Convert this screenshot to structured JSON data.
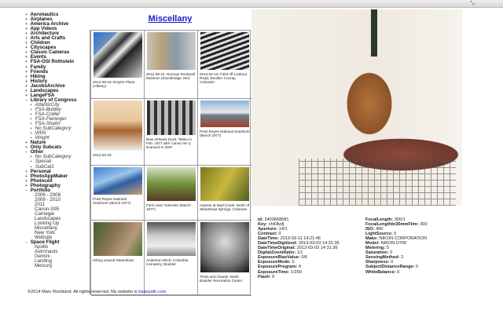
{
  "sidebar": {
    "items": [
      {
        "label": "Aeronautics",
        "level": 0,
        "toggle": "+"
      },
      {
        "label": "Airplanes",
        "level": 0,
        "toggle": "+"
      },
      {
        "label": "America Archive",
        "level": 0,
        "toggle": "+"
      },
      {
        "label": "App Videos",
        "level": 0,
        "toggle": "+"
      },
      {
        "label": "Architecture",
        "level": 0,
        "toggle": "+"
      },
      {
        "label": "Arts and Crafts",
        "level": 0,
        "toggle": "+"
      },
      {
        "label": "Children",
        "level": 0,
        "toggle": "+"
      },
      {
        "label": "Cityscapes",
        "level": 0,
        "toggle": "+"
      },
      {
        "label": "Classic Cameras",
        "level": 0,
        "toggle": "+"
      },
      {
        "label": "Events",
        "level": 0,
        "toggle": "+"
      },
      {
        "label": "FSA-OSI Rothstein",
        "level": 0,
        "toggle": "+"
      },
      {
        "label": "Family",
        "level": 0,
        "toggle": "+"
      },
      {
        "label": "Friends",
        "level": 0,
        "toggle": "+"
      },
      {
        "label": "Hiking",
        "level": 0,
        "toggle": "+"
      },
      {
        "label": "History",
        "level": 0,
        "toggle": "+"
      },
      {
        "label": "JacobsArchive",
        "level": 0,
        "toggle": "+"
      },
      {
        "label": "Landscapes",
        "level": 0,
        "toggle": "+"
      },
      {
        "label": "LangeFSA",
        "level": 0,
        "toggle": "+"
      },
      {
        "label": "Library of Congress",
        "level": 0,
        "toggle": "−"
      },
      {
        "label": "AtlanticCity",
        "level": 1,
        "toggle": "+"
      },
      {
        "label": "FSA-Bubley",
        "level": 1,
        "toggle": "+"
      },
      {
        "label": "FSA-Collier",
        "level": 1,
        "toggle": "+"
      },
      {
        "label": "FSA-Feininger",
        "level": 1,
        "toggle": "+"
      },
      {
        "label": "FSA-Shahn",
        "level": 1,
        "toggle": "+"
      },
      {
        "label": "No SubCategory",
        "level": 1,
        "toggle": "+"
      },
      {
        "label": "WPA",
        "level": 1,
        "toggle": "+"
      },
      {
        "label": "Wright",
        "level": 1,
        "toggle": "+"
      },
      {
        "label": "Nature",
        "level": 0,
        "toggle": "+"
      },
      {
        "label": "Only Subcats",
        "level": 0,
        "toggle": "+"
      },
      {
        "label": "Other",
        "level": 0,
        "toggle": "−"
      },
      {
        "label": "No SubCategory",
        "level": 1,
        "toggle": "+"
      },
      {
        "label": "Special",
        "level": 1,
        "toggle": "+"
      },
      {
        "label": "SubCat1",
        "level": 1,
        "toggle": "+"
      },
      {
        "label": "Personal",
        "level": 0,
        "toggle": "+"
      },
      {
        "label": "PhotoAppMaker",
        "level": 0,
        "toggle": "+"
      },
      {
        "label": "Photocell",
        "level": 0,
        "toggle": "+"
      },
      {
        "label": "Photography",
        "level": 0,
        "toggle": "+"
      },
      {
        "label": "Portfolio",
        "level": 0,
        "toggle": "−"
      },
      {
        "label": "2006 - 2008",
        "level": 2,
        "toggle": ""
      },
      {
        "label": "2009 - 2010",
        "level": 2,
        "toggle": ""
      },
      {
        "label": "2011",
        "level": 2,
        "toggle": ""
      },
      {
        "label": "Canon-S95",
        "level": 2,
        "toggle": ""
      },
      {
        "label": "Carnegie",
        "level": 2,
        "toggle": ""
      },
      {
        "label": "Landscapes",
        "level": 2,
        "toggle": ""
      },
      {
        "label": "Looking Up",
        "level": 2,
        "toggle": ""
      },
      {
        "label": "Miscellany",
        "level": 2,
        "toggle": ""
      },
      {
        "label": "New York",
        "level": 2,
        "toggle": ""
      },
      {
        "label": "Website",
        "level": 2,
        "toggle": ""
      },
      {
        "label": "Space Flight",
        "level": 0,
        "toggle": "−"
      },
      {
        "label": "Apollo",
        "level": 2,
        "toggle": ""
      },
      {
        "label": "Astronauts",
        "level": 2,
        "toggle": ""
      },
      {
        "label": "Gemini",
        "level": 2,
        "toggle": ""
      },
      {
        "label": "Landing",
        "level": 2,
        "toggle": ""
      },
      {
        "label": "Mercury",
        "level": 2,
        "toggle": ""
      }
    ]
  },
  "gallery": {
    "title": "Miscellany",
    "cells": [
      {
        "caption": "2012-09-23: Empire Plaza (Albany)",
        "thumb": "linear-gradient(135deg,#2a6fd0 0%,#6b8fbf 25%,#ddd 26%,#333 40%,#eee 50%,#222 60%,#ccc 100%)",
        "h": 58
      },
      {
        "caption": "2012-09-24: Norman Rockwell Museum (Stockbridge, MA)",
        "thumb": "linear-gradient(90deg,#c9c4b8,#b7a27a 30%,#8a99aa 60%,#d0cdc6)",
        "h": 48
      },
      {
        "caption": "2013-02-15: Field off Lookout Road, Boulder County, Colorado",
        "thumb": "repeating-linear-gradient(160deg,#222 0 3px,#ddd 3px 6px)",
        "h": 48
      },
      {
        "caption": "2013-03-03",
        "thumb": "linear-gradient(#f0d8b8,#e8c69a 40%,#a5642f 60%,#f3eee8)",
        "h": 64
      },
      {
        "caption": "New Orleans Dock: Taken in Feb. 1977 with Canon AE-1; scanned in 2007",
        "thumb": "repeating-linear-gradient(90deg,#333 0 4px,#bbb 4px 9px)",
        "h": 44
      },
      {
        "caption": "Point Reyes National Seashore (March 1977)",
        "thumb": "linear-gradient(#8fb4d8,#e8e8e8 45%,#6c7f90 55%,#a4402b)",
        "h": 34
      },
      {
        "caption": "Point Reyes National Seashore (March 1977)",
        "thumb": "linear-gradient(160deg,#3d7fd8,#9bc6e8 40%,#2e5fa0 60%,#c2a27a)",
        "h": 35
      },
      {
        "caption": "Farm near Yosemite (March 1977)",
        "thumb": "linear-gradient(#d9e2c6,#6f8f3a 50%,#5a3b26)",
        "h": 43
      },
      {
        "caption": "Aspens at Mad Creek, North of Steamboat Springs, Colorado",
        "thumb": "linear-gradient(120deg,#7a7a1e,#c9b83e 50%,#4f5f22)",
        "h": 43
      },
      {
        "caption": "Hiking around Steamboat",
        "thumb": "linear-gradient(120deg,#3f5f2a,#8a7456 40%,#b49a7a 70%,#4d6e33)",
        "h": 43
      },
      {
        "caption": "Anderson Ditch: Columbia Cemetery, Boulder",
        "thumb": "linear-gradient(#555,#ccc 40%,#eee 70%,#888)",
        "h": 43
      },
      {
        "caption": "Trees and Clouds, North Boulder Recreation Center",
        "thumb": "radial-gradient(circle at 50% 40%,#ddd,#777 60%,#111)",
        "h": 64
      }
    ]
  },
  "exif": {
    "left": [
      {
        "k": "id",
        "v": "2403668581"
      },
      {
        "k": "Key",
        "v": "chK8wfj"
      },
      {
        "k": "Aperture",
        "v": "14/1"
      },
      {
        "k": "Contrast",
        "v": "0"
      },
      {
        "k": "DateTime",
        "v": "2013-03-11 14:21:46"
      },
      {
        "k": "DateTimeDigitized",
        "v": "2013-03-03 14:31:36"
      },
      {
        "k": "DateTimeOriginal",
        "v": "2013-03-03 14:31:36"
      },
      {
        "k": "DigitalZoomRatio",
        "v": "1/1"
      },
      {
        "k": "ExposureBiasValue",
        "v": "0/6"
      },
      {
        "k": "ExposureMode",
        "v": "0"
      },
      {
        "k": "ExposureProgram",
        "v": "4"
      },
      {
        "k": "ExposureTime",
        "v": "1/250"
      },
      {
        "k": "Flash",
        "v": "0"
      }
    ],
    "right": [
      {
        "k": "FocalLength",
        "v": "300/1"
      },
      {
        "k": "FocalLengthIn35mmFilm",
        "v": "300"
      },
      {
        "k": "ISO",
        "v": "400"
      },
      {
        "k": "LightSource",
        "v": "0"
      },
      {
        "k": "Make",
        "v": "NIKON CORPORATION"
      },
      {
        "k": "Model",
        "v": "NIKON D700"
      },
      {
        "k": "Metering",
        "v": "5"
      },
      {
        "k": "Saturation",
        "v": "0"
      },
      {
        "k": "SensingMethod",
        "v": "2"
      },
      {
        "k": "Sharpness",
        "v": "0"
      },
      {
        "k": "SubjectDistanceRange",
        "v": "0"
      },
      {
        "k": "WhiteBalance",
        "v": "0"
      }
    ]
  },
  "footer": {
    "text": "©2014 Marc Rochkind. All rights reserved. My website is ",
    "link": "basepath.com"
  }
}
